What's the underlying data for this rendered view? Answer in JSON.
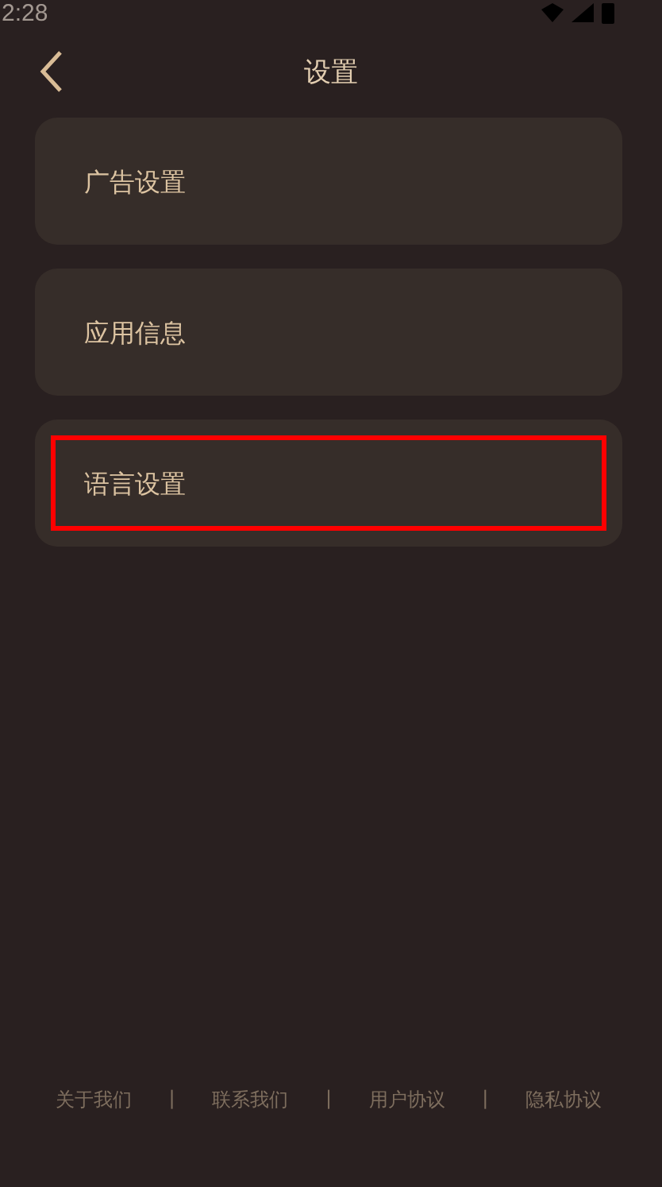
{
  "status_bar": {
    "time": "2:28"
  },
  "header": {
    "title": "设置"
  },
  "items": [
    {
      "label": "广告设置",
      "highlighted": false
    },
    {
      "label": "应用信息",
      "highlighted": false
    },
    {
      "label": "语言设置",
      "highlighted": true
    }
  ],
  "footer": {
    "links": [
      "关于我们",
      "联系我们",
      "用户协议",
      "隐私协议"
    ],
    "separator": "|"
  }
}
